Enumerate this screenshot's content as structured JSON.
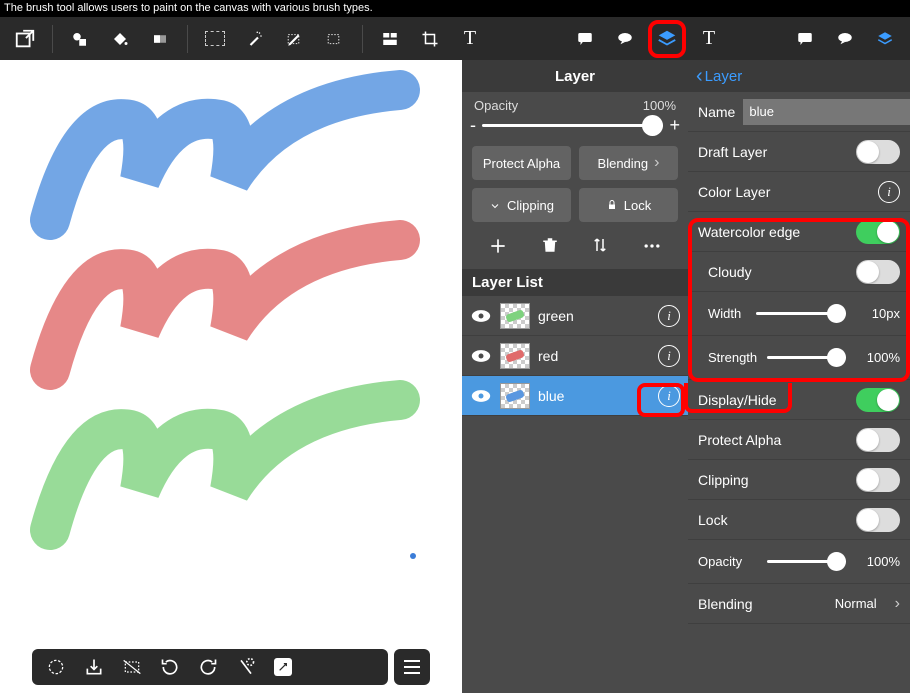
{
  "tooltip": "The brush tool allows users to paint on the canvas with various brush types.",
  "panel1": {
    "title": "Layer",
    "opacityLabel": "Opacity",
    "opacityValue": "100%",
    "minus": "-",
    "plus": "+",
    "protectAlpha": "Protect Alpha",
    "blending": "Blending",
    "clipping": "Clipping",
    "lock": "Lock",
    "listHeader": "Layer List",
    "layers": [
      {
        "name": "green",
        "color": "#7ed27e"
      },
      {
        "name": "red",
        "color": "#e06a6a"
      },
      {
        "name": "blue",
        "color": "#5a97e0"
      }
    ]
  },
  "panel2": {
    "back": "Layer",
    "nameLabel": "Name",
    "nameValue": "blue",
    "draftLayer": "Draft Layer",
    "colorLayer": "Color Layer",
    "watercolorEdge": "Watercolor edge",
    "cloudy": "Cloudy",
    "widthLabel": "Width",
    "widthValue": "10px",
    "strengthLabel": "Strength",
    "strengthValue": "100%",
    "displayHide": "Display/Hide",
    "protectAlpha": "Protect Alpha",
    "clipping": "Clipping",
    "lock": "Lock",
    "opacityLabel": "Opacity",
    "opacityValue": "100%",
    "blendingLabel": "Blending",
    "blendingValue": "Normal"
  }
}
